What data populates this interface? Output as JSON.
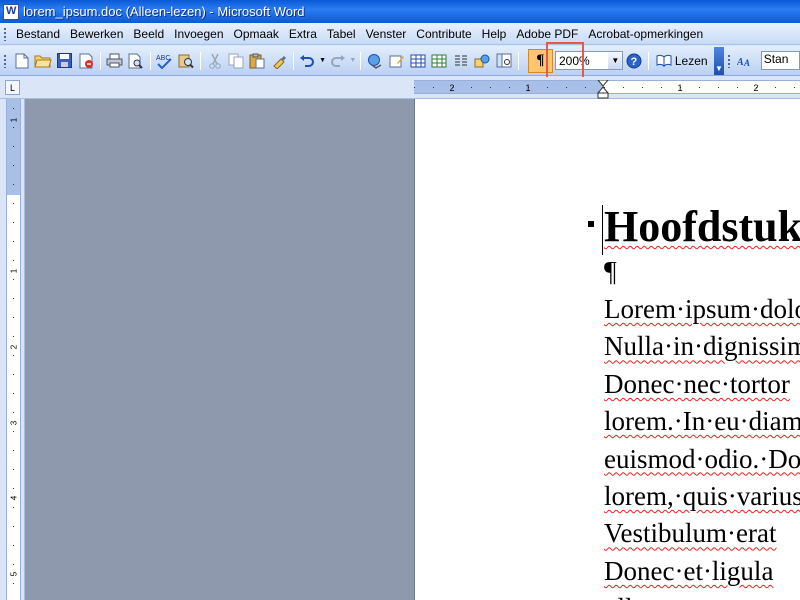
{
  "window": {
    "title": "lorem_ipsum.doc (Alleen-lezen) - Microsoft Word"
  },
  "menu": [
    {
      "label": "Bestand"
    },
    {
      "label": "Bewerken"
    },
    {
      "label": "Beeld"
    },
    {
      "label": "Invoegen"
    },
    {
      "label": "Opmaak"
    },
    {
      "label": "Extra"
    },
    {
      "label": "Tabel"
    },
    {
      "label": "Venster"
    },
    {
      "label": "Contribute"
    },
    {
      "label": "Help"
    },
    {
      "label": "Adobe PDF"
    },
    {
      "label": "Acrobat-opmerkingen"
    }
  ],
  "toolbar": {
    "show_formatting_glyph": "¶",
    "zoom_value": "200%",
    "read_label": "Lezen",
    "style_value": "Stan"
  },
  "ruler": {
    "h_labels": [
      "2",
      "1",
      "1",
      "2"
    ],
    "v_labels": [
      "1",
      "1",
      "2",
      "3",
      "4",
      "5"
    ]
  },
  "document": {
    "heading": "Hoofdstuk",
    "empty_paragraph_mark": "¶",
    "lines": [
      "Lorem·ipsum·dolor",
      "Nulla·in·dignissim",
      "Donec·nec·tortor",
      "lorem.·In·eu·diam",
      "euismod·odio.·Donec",
      "lorem,·quis·varius",
      "Vestibulum·erat",
      "Donec·et·ligula",
      "ullamcorper"
    ]
  },
  "colors": {
    "titlebar": "#0a58d8",
    "highlight_box": "#e8574b",
    "active_button": "#ffc66d",
    "workspace_gray": "#8e99ad",
    "spellcheck_squiggle": "#e0241a"
  }
}
